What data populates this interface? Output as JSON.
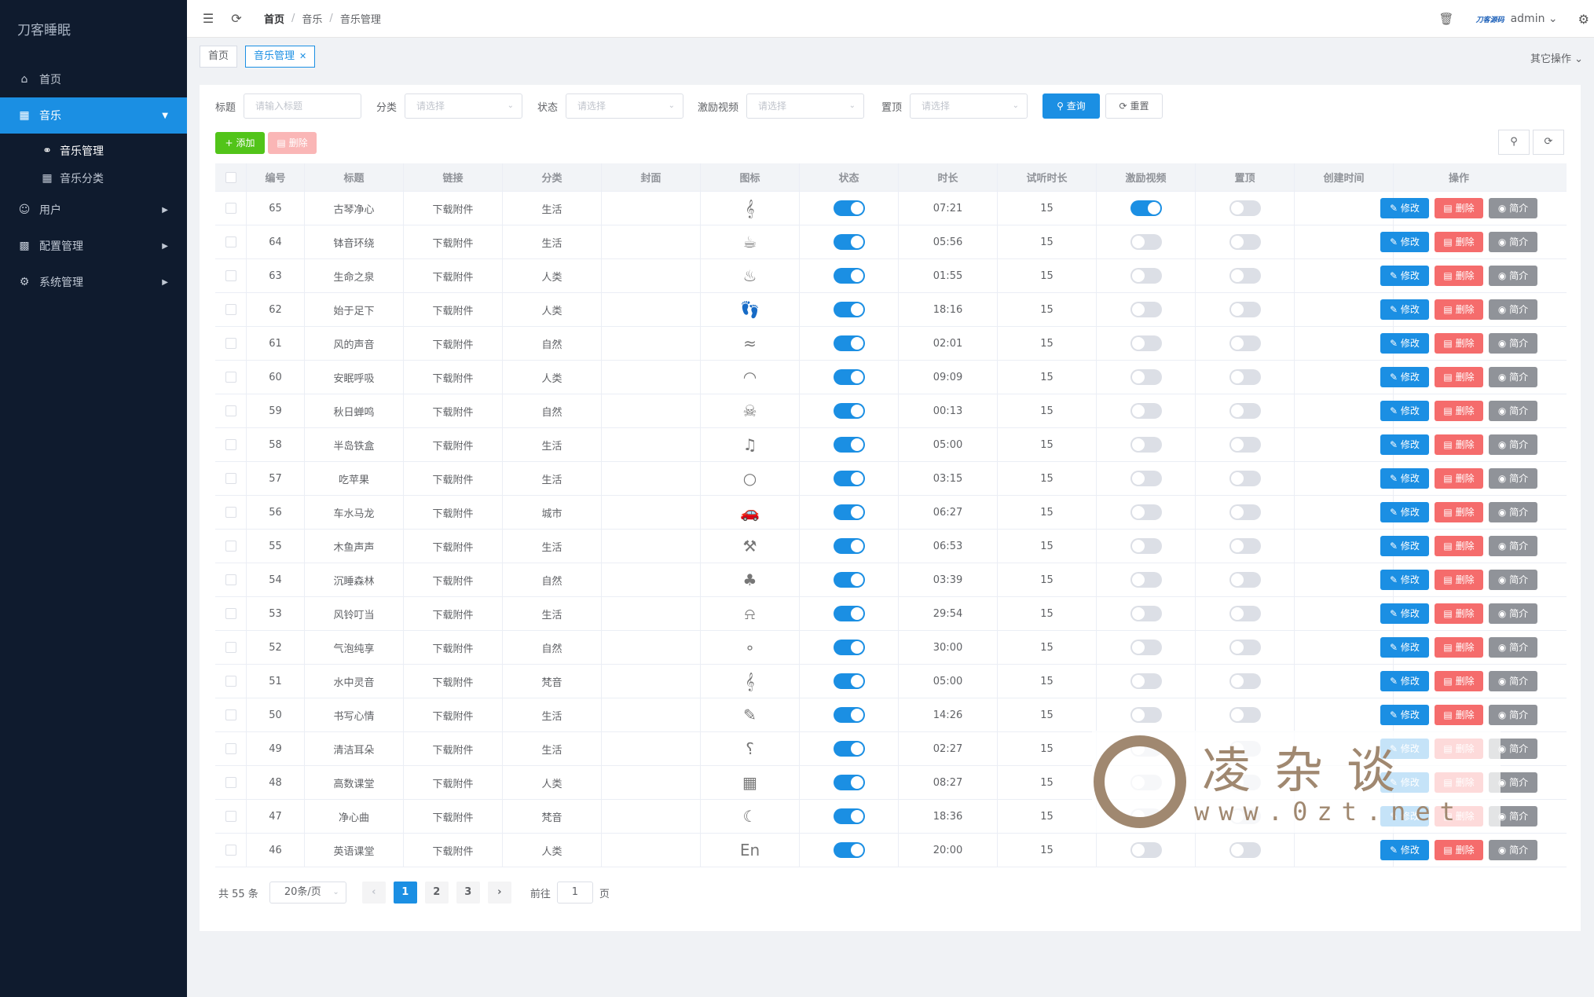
{
  "app": {
    "title": "刀客睡眠"
  },
  "sidebar": {
    "items": [
      {
        "label": "首页",
        "icon": "home-icon"
      },
      {
        "label": "音乐",
        "icon": "grid-icon"
      },
      {
        "label": "音乐管理",
        "icon": "headphones-icon"
      },
      {
        "label": "音乐分类",
        "icon": "table-icon"
      },
      {
        "label": "用户",
        "icon": "user-icon"
      },
      {
        "label": "配置管理",
        "icon": "bar-chart-icon"
      },
      {
        "label": "系统管理",
        "icon": "gear-icon"
      }
    ]
  },
  "header": {
    "breadcrumb": [
      "首页",
      "音乐",
      "音乐管理"
    ],
    "brand": "刀客源码",
    "user": "admin"
  },
  "tags": {
    "items": [
      "首页",
      "音乐管理"
    ],
    "other": "其它操作"
  },
  "filters": {
    "title_label": "标题",
    "title_placeholder": "请输入标题",
    "category_label": "分类",
    "category_placeholder": "请选择",
    "status_label": "状态",
    "status_placeholder": "请选择",
    "video_label": "激励视频",
    "video_placeholder": "请选择",
    "top_label": "置顶",
    "top_placeholder": "请选择",
    "query": "查询",
    "reset": "重置"
  },
  "toolbar": {
    "add": "添加",
    "delete": "删除"
  },
  "table": {
    "headers": [
      "编号",
      "标题",
      "链接",
      "分类",
      "封面",
      "图标",
      "状态",
      "时长",
      "试听时长",
      "激励视频",
      "置顶",
      "创建时间",
      "操作"
    ],
    "rows": [
      {
        "id": "65",
        "title": "古琴净心",
        "link": "下载附件",
        "cat": "生活",
        "icon": "lyre-icon",
        "status": true,
        "dur": "07:21",
        "trial": "15",
        "video": true,
        "top": false
      },
      {
        "id": "64",
        "title": "钵音环绕",
        "link": "下载附件",
        "cat": "生活",
        "icon": "singing-bowl-icon",
        "status": true,
        "dur": "05:56",
        "trial": "15",
        "video": false,
        "top": false
      },
      {
        "id": "63",
        "title": "生命之泉",
        "link": "下载附件",
        "cat": "人类",
        "icon": "cup-icon",
        "status": true,
        "dur": "01:55",
        "trial": "15",
        "video": false,
        "top": false
      },
      {
        "id": "62",
        "title": "始于足下",
        "link": "下载附件",
        "cat": "人类",
        "icon": "footprints-icon",
        "status": true,
        "dur": "18:16",
        "trial": "15",
        "video": false,
        "top": false
      },
      {
        "id": "61",
        "title": "风的声音",
        "link": "下载附件",
        "cat": "自然",
        "icon": "wind-icon",
        "status": true,
        "dur": "02:01",
        "trial": "15",
        "video": false,
        "top": false
      },
      {
        "id": "60",
        "title": "安眠呼吸",
        "link": "下载附件",
        "cat": "人类",
        "icon": "lips-icon",
        "status": true,
        "dur": "09:09",
        "trial": "15",
        "video": false,
        "top": false
      },
      {
        "id": "59",
        "title": "秋日蝉鸣",
        "link": "下载附件",
        "cat": "自然",
        "icon": "cicada-icon",
        "status": true,
        "dur": "00:13",
        "trial": "15",
        "video": false,
        "top": false
      },
      {
        "id": "58",
        "title": "半岛铁盒",
        "link": "下载附件",
        "cat": "生活",
        "icon": "music-box-icon",
        "status": true,
        "dur": "05:00",
        "trial": "15",
        "video": false,
        "top": false
      },
      {
        "id": "57",
        "title": "吃苹果",
        "link": "下载附件",
        "cat": "生活",
        "icon": "apple-icon",
        "status": true,
        "dur": "03:15",
        "trial": "15",
        "video": false,
        "top": false
      },
      {
        "id": "56",
        "title": "车水马龙",
        "link": "下载附件",
        "cat": "城市",
        "icon": "car-icon",
        "status": true,
        "dur": "06:27",
        "trial": "15",
        "video": false,
        "top": false
      },
      {
        "id": "55",
        "title": "木鱼声声",
        "link": "下载附件",
        "cat": "生活",
        "icon": "wooden-fish-icon",
        "status": true,
        "dur": "06:53",
        "trial": "15",
        "video": false,
        "top": false
      },
      {
        "id": "54",
        "title": "沉睡森林",
        "link": "下载附件",
        "cat": "自然",
        "icon": "forest-icon",
        "status": true,
        "dur": "03:39",
        "trial": "15",
        "video": false,
        "top": false
      },
      {
        "id": "53",
        "title": "风铃叮当",
        "link": "下载附件",
        "cat": "生活",
        "icon": "wind-chime-icon",
        "status": true,
        "dur": "29:54",
        "trial": "15",
        "video": false,
        "top": false
      },
      {
        "id": "52",
        "title": "气泡纯享",
        "link": "下载附件",
        "cat": "自然",
        "icon": "bubbles-icon",
        "status": true,
        "dur": "30:00",
        "trial": "15",
        "video": false,
        "top": false
      },
      {
        "id": "51",
        "title": "水中灵音",
        "link": "下载附件",
        "cat": "梵音",
        "icon": "treble-clef-icon",
        "status": true,
        "dur": "05:00",
        "trial": "15",
        "video": false,
        "top": false
      },
      {
        "id": "50",
        "title": "书写心情",
        "link": "下载附件",
        "cat": "生活",
        "icon": "pen-paper-icon",
        "status": true,
        "dur": "14:26",
        "trial": "15",
        "video": false,
        "top": false
      },
      {
        "id": "49",
        "title": "清洁耳朵",
        "link": "下载附件",
        "cat": "生活",
        "icon": "ear-icon",
        "status": true,
        "dur": "02:27",
        "trial": "15",
        "video": false,
        "top": false
      },
      {
        "id": "48",
        "title": "高数课堂",
        "link": "下载附件",
        "cat": "人类",
        "icon": "calculator-icon",
        "status": true,
        "dur": "08:27",
        "trial": "15",
        "video": false,
        "top": false
      },
      {
        "id": "47",
        "title": "净心曲",
        "link": "下载附件",
        "cat": "梵音",
        "icon": "moon-icon",
        "status": true,
        "dur": "18:36",
        "trial": "15",
        "video": false,
        "top": false
      },
      {
        "id": "46",
        "title": "英语课堂",
        "link": "下载附件",
        "cat": "人类",
        "icon": "english-icon",
        "status": true,
        "dur": "20:00",
        "trial": "15",
        "video": false,
        "top": false
      }
    ],
    "ops": {
      "edit": "修改",
      "delete": "删除",
      "info": "简介"
    }
  },
  "pagination": {
    "total": "共 55 条",
    "size": "20条/页",
    "pages": [
      "1",
      "2",
      "3"
    ],
    "goto": "前往",
    "page_unit": "页",
    "current": "1"
  },
  "watermark": {
    "text": "凌杂谈",
    "url": "www.0zt.net"
  }
}
